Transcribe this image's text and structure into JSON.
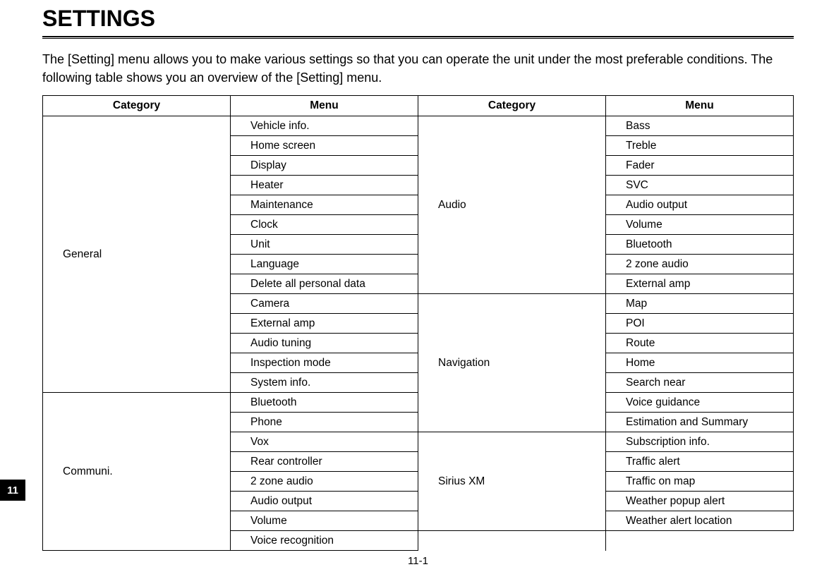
{
  "heading": "SETTINGS",
  "intro": "The [Setting] menu allows you to make various settings so that you can operate the unit under the most preferable conditions. The following table shows you an overview of the [Setting] menu.",
  "table": {
    "headers": [
      "Category",
      "Menu",
      "Category",
      "Menu"
    ],
    "left": [
      {
        "category": "General",
        "items": [
          "Vehicle info.",
          "Home screen",
          "Display",
          "Heater",
          "Maintenance",
          "Clock",
          "Unit",
          "Language",
          "Delete all personal data",
          "Camera",
          "External amp",
          "Audio tuning",
          "Inspection mode",
          "System info."
        ]
      },
      {
        "category": "Communi.",
        "items": [
          "Bluetooth",
          "Phone",
          "Vox",
          "Rear controller",
          "2 zone audio",
          "Audio output",
          "Volume",
          "Voice recognition"
        ]
      }
    ],
    "right": [
      {
        "category": "Audio",
        "items": [
          "Bass",
          "Treble",
          "Fader",
          "SVC",
          "Audio output",
          "Volume",
          "Bluetooth",
          "2 zone audio",
          "External amp"
        ]
      },
      {
        "category": "Navigation",
        "items": [
          "Map",
          "POI",
          "Route",
          "Home",
          "Search near",
          "Voice guidance",
          "Estimation and Summary"
        ]
      },
      {
        "category": "Sirius XM",
        "items": [
          "Subscription info.",
          "Traffic alert",
          "Traffic on map",
          "Weather popup alert",
          "Weather alert location"
        ]
      }
    ]
  },
  "side_tab": "11",
  "page_number": "11-1"
}
